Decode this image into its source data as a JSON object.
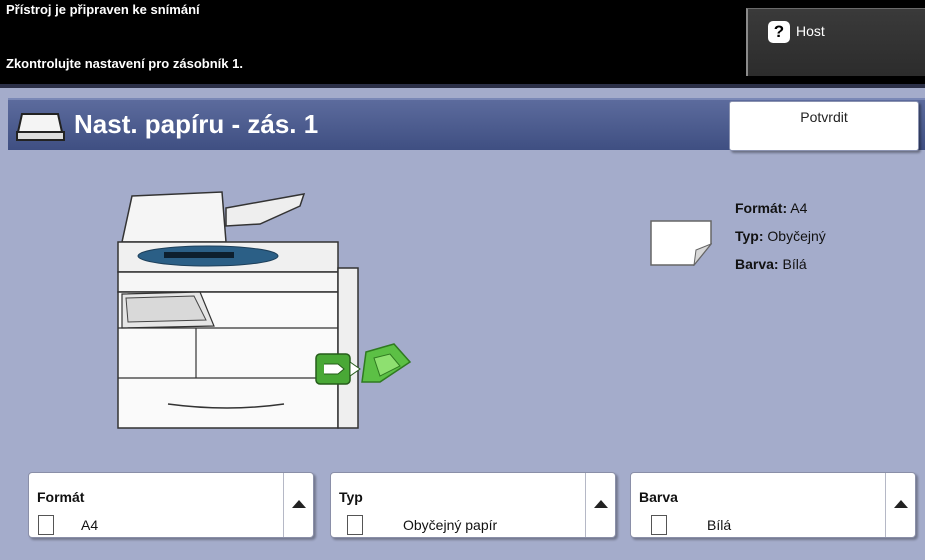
{
  "status": {
    "line1": "Přístroj je připraven ke snímání",
    "line2": "Zkontrolujte nastavení pro zásobník 1.",
    "host_label": "Host",
    "help_glyph": "?"
  },
  "header": {
    "title": "Nast. papíru - zás. 1",
    "confirm_label": "Potvrdit"
  },
  "paper_info": {
    "format_label": "Formát:",
    "format_value": "A4",
    "type_label": "Typ:",
    "type_value": "Obyčejný",
    "color_label": "Barva:",
    "color_value": "Bílá"
  },
  "selectors": [
    {
      "title": "Formát",
      "value": "A4"
    },
    {
      "title": "Typ",
      "value": "Obyčejný papír"
    },
    {
      "title": "Barva",
      "value": "Bílá"
    }
  ],
  "icons": {
    "tray": "paper-tray-icon",
    "printer": "printer-illustration",
    "paper": "paper-sheet-icon",
    "help": "help-icon"
  },
  "colors": {
    "panel_bg": "#a4accb",
    "title_bar": "#4b5a8c",
    "accent_green": "#4caf3a"
  }
}
